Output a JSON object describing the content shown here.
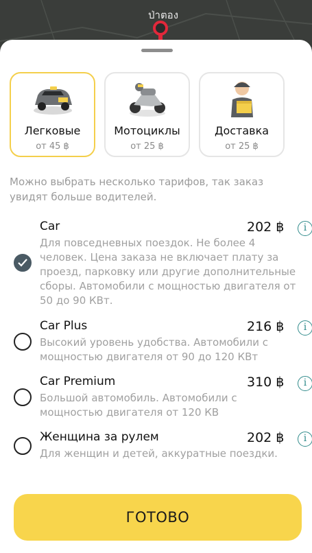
{
  "map": {
    "place_label": "ป่าตอง"
  },
  "categories": [
    {
      "title": "Легковые",
      "price": "от 45 ฿",
      "icon": "car-icon",
      "selected": true
    },
    {
      "title": "Мотоциклы",
      "price": "от 25 ฿",
      "icon": "motorcycle-icon",
      "selected": false
    },
    {
      "title": "Доставка",
      "price": "от 25 ฿",
      "icon": "courier-icon",
      "selected": false
    }
  ],
  "hint": "Можно выбрать несколько тарифов, так заказ увидят больше водителей.",
  "tariffs": [
    {
      "name": "Car",
      "price": "202 ฿",
      "description": "Для повседневных поездок. Не более 4 человек. Цена заказа не включает плату за проезд, парковку или другие дополнительные сборы. Автомобили с мощностью двигателя от 50 до 90 КВт.",
      "checked": true
    },
    {
      "name": "Car Plus",
      "price": "216 ฿",
      "description": "Высокий уровень удобства. Автомобили с мощностью двигателя от 90 до 120 КВт",
      "checked": false
    },
    {
      "name": "Car Premium",
      "price": "310 ฿",
      "description": "Большой автомобиль. Автомобили с мощностью двигателя от 120 КВ",
      "checked": false
    },
    {
      "name": "Женщина за рулем",
      "price": "202 ฿",
      "description": "Для женщин и детей, аккуратные поездки.",
      "checked": false
    }
  ],
  "info_glyph": "i",
  "done_button": "ГОТОВО",
  "colors": {
    "accent": "#f8d54c",
    "selected_border": "#f4cf4b",
    "checked_radio": "#4a5a64",
    "info": "#2f8a8a"
  }
}
